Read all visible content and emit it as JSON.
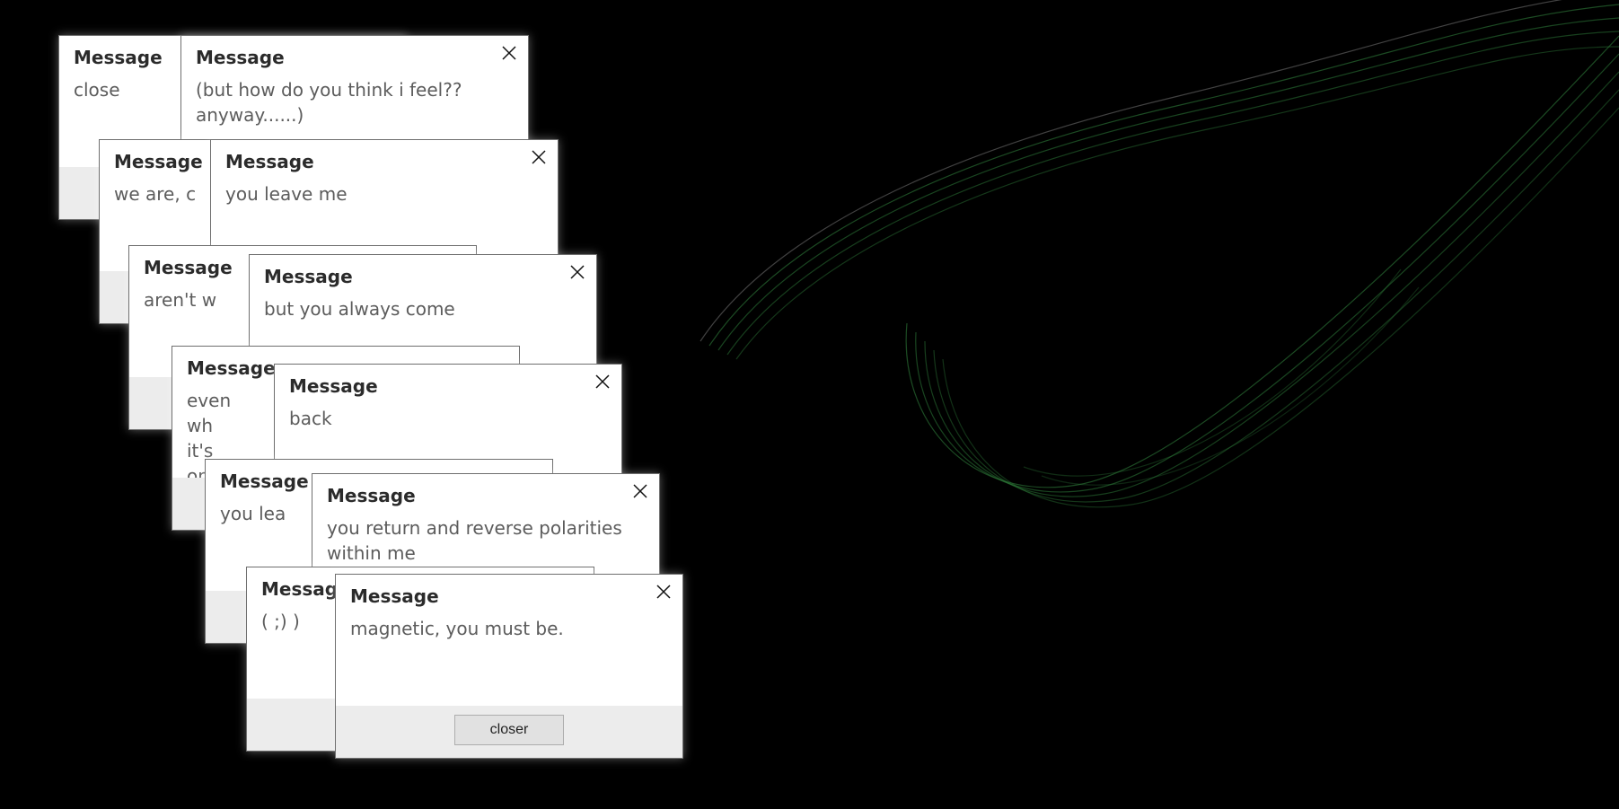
{
  "dialogs": [
    {
      "title": "Message",
      "text": "close"
    },
    {
      "title": "Message",
      "text": "(but how do you think i feel?? anyway......)"
    },
    {
      "title": "Message",
      "text": "we are, c"
    },
    {
      "title": "Message",
      "text": "you leave me"
    },
    {
      "title": "Message",
      "text": "aren't w"
    },
    {
      "title": "Message",
      "text": "but you always come"
    },
    {
      "title": "Message",
      "text": "even wh it's only"
    },
    {
      "title": "Message",
      "text": "back"
    },
    {
      "title": "Message",
      "text": "you lea"
    },
    {
      "title": "Message",
      "text": "you return and reverse polarities within me"
    },
    {
      "title": "Message",
      "text": "( ;) )"
    },
    {
      "title": "Message",
      "text": "magnetic, you must be.",
      "button": "closer"
    }
  ],
  "icons": {
    "close": "close-x-icon"
  },
  "colors": {
    "background": "#000000",
    "ribbon": "#2e7d3a",
    "ribbon_edge": "#8a8a8a"
  }
}
